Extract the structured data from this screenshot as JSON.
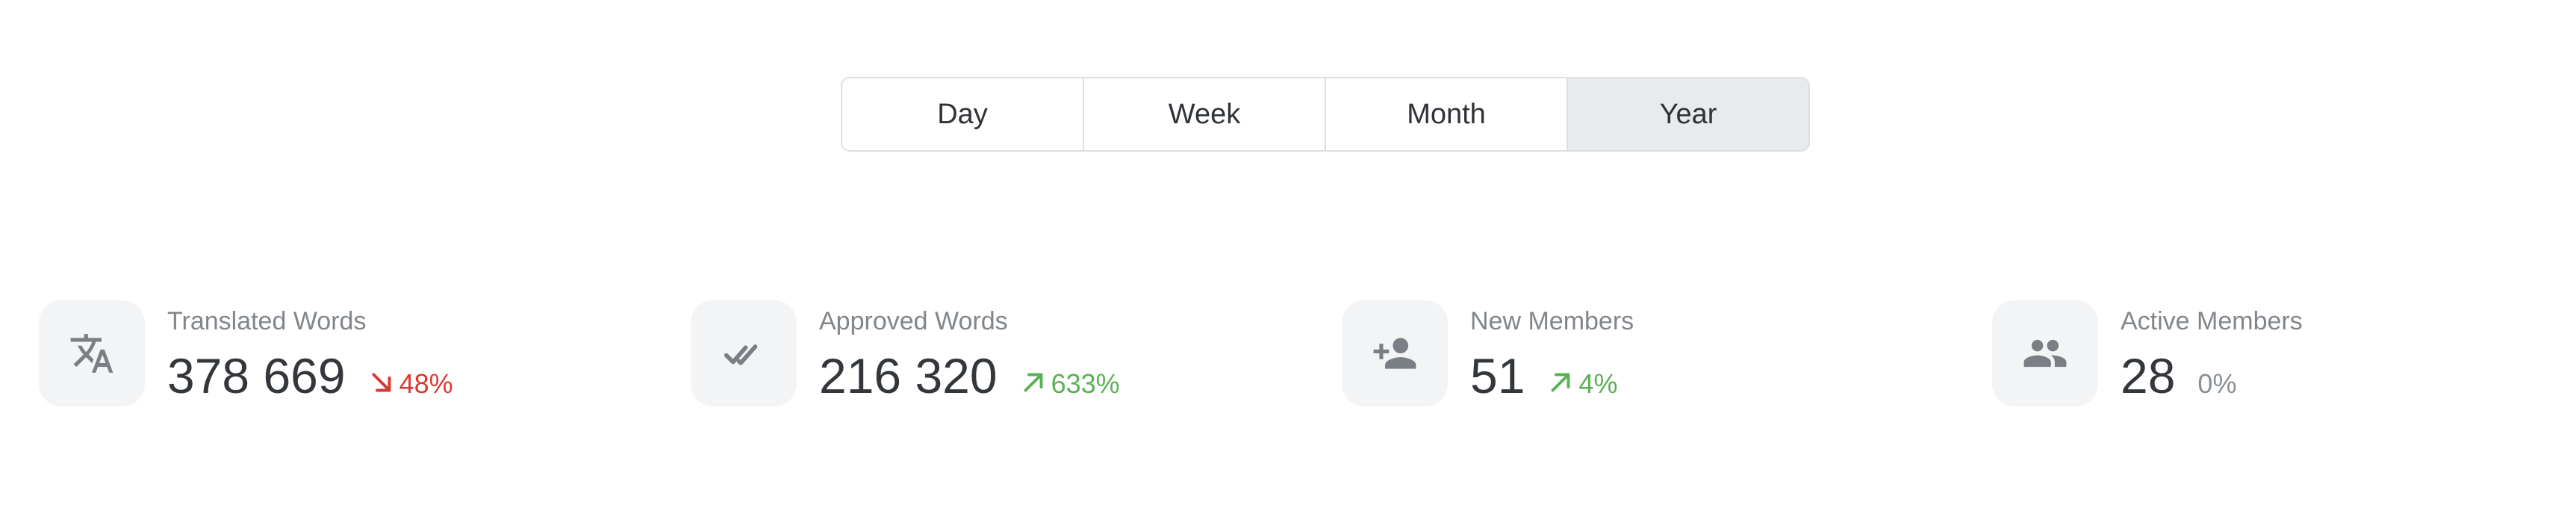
{
  "period_selector": {
    "options": [
      {
        "label": "Day",
        "active": false
      },
      {
        "label": "Week",
        "active": false
      },
      {
        "label": "Month",
        "active": false
      },
      {
        "label": "Year",
        "active": true
      }
    ]
  },
  "stats": [
    {
      "icon": "translate-icon",
      "label": "Translated Words",
      "value": "378 669",
      "change": "48%",
      "trend": "down",
      "trend_color": "#d93a30"
    },
    {
      "icon": "double-check-icon",
      "label": "Approved Words",
      "value": "216 320",
      "change": "633%",
      "trend": "up",
      "trend_color": "#5ab153"
    },
    {
      "icon": "person-add-icon",
      "label": "New Members",
      "value": "51",
      "change": "4%",
      "trend": "up",
      "trend_color": "#5ab153"
    },
    {
      "icon": "people-icon",
      "label": "Active Members",
      "value": "28",
      "change": "0%",
      "trend": "neutral",
      "trend_color": "#8a8f94"
    }
  ]
}
